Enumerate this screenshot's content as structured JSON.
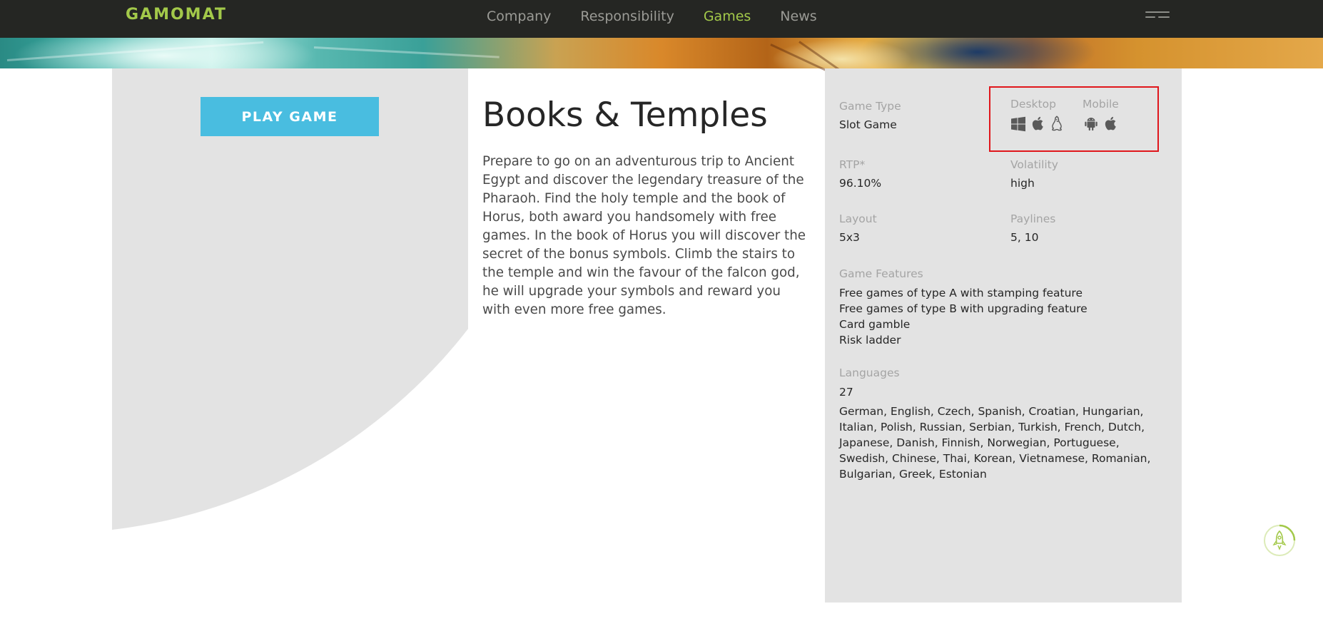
{
  "brand": {
    "logo_text": "GAMOMAT",
    "accent_color": "#a3c94a"
  },
  "nav": {
    "links": [
      {
        "label": "Company",
        "active": false
      },
      {
        "label": "Responsibility",
        "active": false
      },
      {
        "label": "Games",
        "active": true
      },
      {
        "label": "News",
        "active": false
      }
    ],
    "menu_icon": "hamburger-menu-icon"
  },
  "play_button": {
    "label": "PLAY GAME",
    "color": "#49bde0"
  },
  "game": {
    "title": "Books & Temples",
    "description": "Prepare to go on an adventurous trip to Ancient Egypt and discover the legendary treasure of the Pharaoh. Find the holy temple and the book of Horus, both award you handsomely with free games. In the book of Horus you will discover the secret of the bonus symbols. Climb the stairs to the temple and win the favour of the falcon god, he will upgrade your symbols and reward you with even more free games."
  },
  "details": {
    "game_type": {
      "label": "Game Type",
      "value": "Slot Game"
    },
    "desktop": {
      "label": "Desktop",
      "icons": [
        "windows-icon",
        "apple-icon",
        "linux-icon"
      ]
    },
    "mobile": {
      "label": "Mobile",
      "icons": [
        "android-icon",
        "apple-icon"
      ]
    },
    "rtp": {
      "label": "RTP*",
      "value": "96.10%"
    },
    "volatility": {
      "label": "Volatility",
      "value": "high"
    },
    "layout": {
      "label": "Layout",
      "value": "5x3"
    },
    "paylines": {
      "label": "Paylines",
      "value": "5, 10"
    },
    "features": {
      "label": "Game Features",
      "items": [
        "Free games of type A with stamping feature",
        "Free games of type B with upgrading feature",
        "Card gamble",
        "Risk ladder"
      ]
    },
    "languages": {
      "label": "Languages",
      "count": "27",
      "list": "German, English, Czech, Spanish, Croatian, Hungarian, Italian, Polish, Russian, Serbian, Turkish, French, Dutch, Japanese, Danish, Finnish, Norwegian, Portuguese, Swedish, Chinese, Thai, Korean, Vietnamese, Romanian, Bulgarian, Greek, Estonian"
    }
  },
  "highlight_color": "#e0161c",
  "scroll_top_icon": "rocket-icon"
}
